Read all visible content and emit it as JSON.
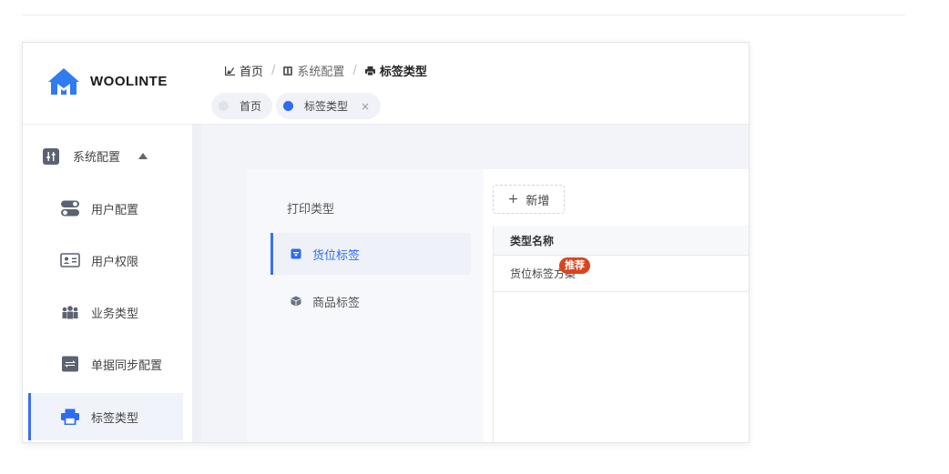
{
  "app": {
    "logo_text": "WOOLINTE"
  },
  "breadcrumb": [
    {
      "label": "首页",
      "icon": "chart-icon"
    },
    {
      "label": "系统配置",
      "icon": "grid-icon"
    },
    {
      "label": "标签类型",
      "icon": "printer-icon"
    }
  ],
  "tabs": [
    {
      "label": "首页",
      "active": false
    },
    {
      "label": "标签类型",
      "active": true,
      "close": "×"
    }
  ],
  "sidebar": {
    "group": {
      "label": "系统配置",
      "icon": "settings-sliders-icon",
      "expanded": true
    },
    "items": [
      {
        "label": "用户配置",
        "icon": "toggle-icon",
        "active": false
      },
      {
        "label": "用户权限",
        "icon": "id-card-icon",
        "active": false
      },
      {
        "label": "业务类型",
        "icon": "users-icon",
        "active": false
      },
      {
        "label": "单据同步配置",
        "icon": "sync-icon",
        "active": false
      },
      {
        "label": "标签类型",
        "icon": "printer-icon",
        "active": true
      }
    ]
  },
  "main": {
    "types_title": "打印类型",
    "types": [
      {
        "label": "货位标签",
        "icon": "location-box-icon",
        "active": true
      },
      {
        "label": "商品标签",
        "icon": "cube-icon",
        "active": false
      }
    ],
    "add_button": {
      "label": "新增",
      "icon": "+"
    },
    "table": {
      "header": "类型名称",
      "rows": [
        {
          "name": "货位标签方案",
          "badge": "推荐"
        }
      ]
    }
  },
  "colors": {
    "accent": "#2f6bf2",
    "badge": "#d9441f"
  }
}
